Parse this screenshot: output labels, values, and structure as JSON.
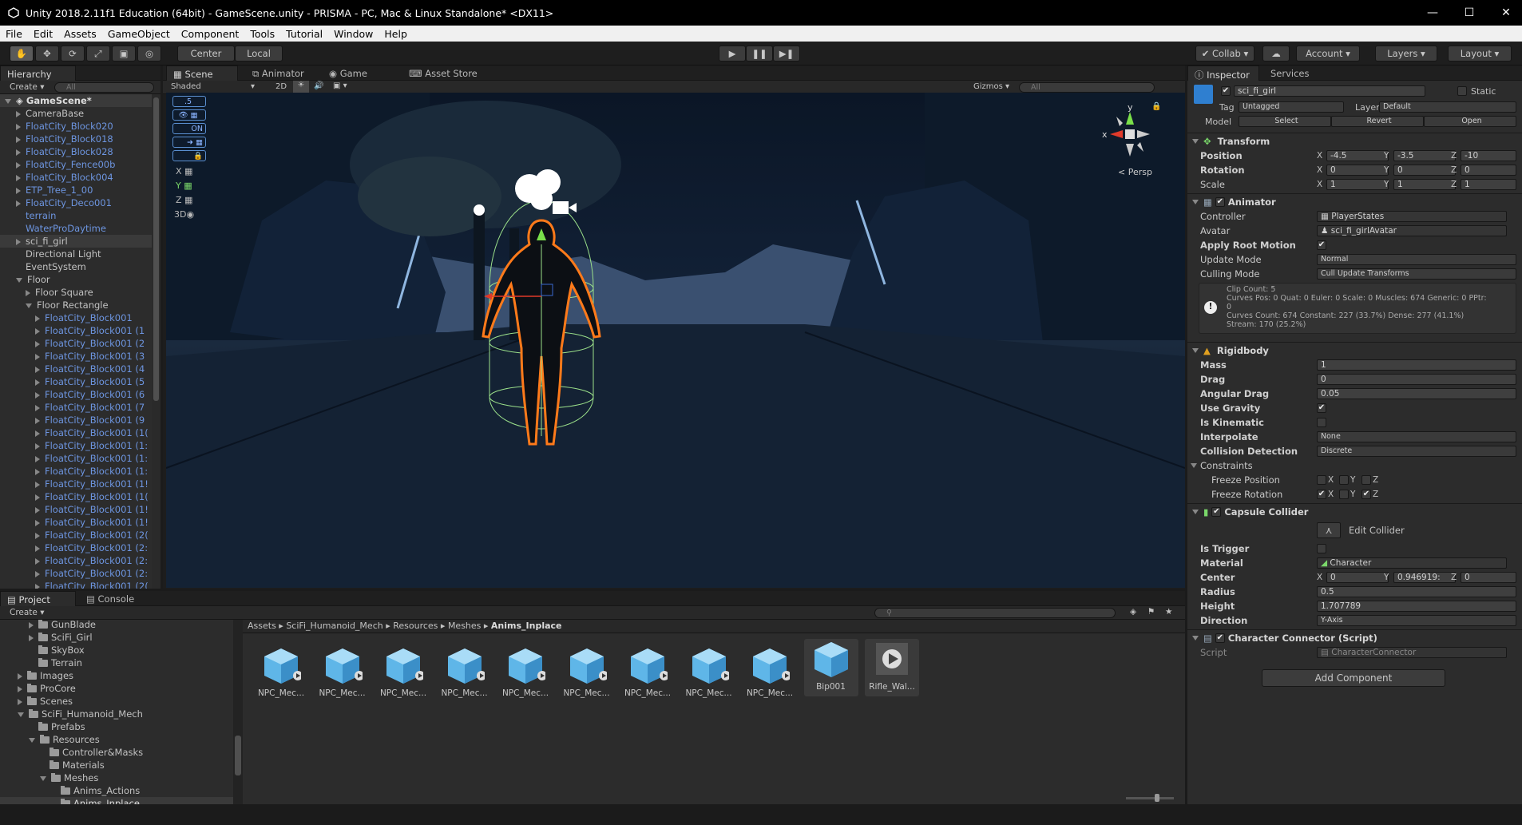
{
  "window": {
    "title": "Unity 2018.2.11f1 Education (64bit) - GameScene.unity - PRISMA - PC, Mac & Linux Standalone* <DX11>"
  },
  "menu": [
    "File",
    "Edit",
    "Assets",
    "GameObject",
    "Component",
    "Tools",
    "Tutorial",
    "Window",
    "Help"
  ],
  "toolbar": {
    "center": "Center",
    "local": "Local",
    "collab": "Collab",
    "account": "Account",
    "layers": "Layers",
    "layout": "Layout"
  },
  "hierarchy": {
    "tab": "Hierarchy",
    "create": "Create",
    "search": "All",
    "scene": "GameScene*",
    "rows": [
      {
        "label": "CameraBase",
        "fold": "closed",
        "indent": 0,
        "blue": false
      },
      {
        "label": "FloatCity_Block020",
        "fold": "closed",
        "indent": 0,
        "blue": true
      },
      {
        "label": "FloatCity_Block018",
        "fold": "closed",
        "indent": 0,
        "blue": true
      },
      {
        "label": "FloatCity_Block028",
        "fold": "closed",
        "indent": 0,
        "blue": true
      },
      {
        "label": "FloatCity_Fence00b",
        "fold": "closed",
        "indent": 0,
        "blue": true
      },
      {
        "label": "FloatCity_Block004",
        "fold": "closed",
        "indent": 0,
        "blue": true
      },
      {
        "label": "ETP_Tree_1_00",
        "fold": "closed",
        "indent": 0,
        "blue": true
      },
      {
        "label": "FloatCity_Deco001",
        "fold": "closed",
        "indent": 0,
        "blue": true
      },
      {
        "label": "terrain",
        "fold": "none",
        "indent": 0,
        "blue": true
      },
      {
        "label": "WaterProDaytime",
        "fold": "none",
        "indent": 0,
        "blue": true
      },
      {
        "label": "sci_fi_girl",
        "fold": "closed",
        "indent": 0,
        "blue": false,
        "selected": true
      },
      {
        "label": "Directional Light",
        "fold": "none",
        "indent": 0,
        "blue": false
      },
      {
        "label": "EventSystem",
        "fold": "none",
        "indent": 0,
        "blue": false
      },
      {
        "label": "Floor",
        "fold": "open",
        "indent": 0,
        "blue": false
      },
      {
        "label": "Floor Square",
        "fold": "closed",
        "indent": 1,
        "blue": false
      },
      {
        "label": "Floor Rectangle",
        "fold": "open",
        "indent": 1,
        "blue": false
      },
      {
        "label": "FloatCity_Block001",
        "fold": "closed",
        "indent": 2,
        "blue": true
      },
      {
        "label": "FloatCity_Block001 (1",
        "fold": "closed",
        "indent": 2,
        "blue": true
      },
      {
        "label": "FloatCity_Block001 (2",
        "fold": "closed",
        "indent": 2,
        "blue": true
      },
      {
        "label": "FloatCity_Block001 (3",
        "fold": "closed",
        "indent": 2,
        "blue": true
      },
      {
        "label": "FloatCity_Block001 (4",
        "fold": "closed",
        "indent": 2,
        "blue": true
      },
      {
        "label": "FloatCity_Block001 (5",
        "fold": "closed",
        "indent": 2,
        "blue": true
      },
      {
        "label": "FloatCity_Block001 (6",
        "fold": "closed",
        "indent": 2,
        "blue": true
      },
      {
        "label": "FloatCity_Block001 (7",
        "fold": "closed",
        "indent": 2,
        "blue": true
      },
      {
        "label": "FloatCity_Block001 (9",
        "fold": "closed",
        "indent": 2,
        "blue": true
      },
      {
        "label": "FloatCity_Block001 (1(",
        "fold": "closed",
        "indent": 2,
        "blue": true
      },
      {
        "label": "FloatCity_Block001 (1:",
        "fold": "closed",
        "indent": 2,
        "blue": true
      },
      {
        "label": "FloatCity_Block001 (1:",
        "fold": "closed",
        "indent": 2,
        "blue": true
      },
      {
        "label": "FloatCity_Block001 (1:",
        "fold": "closed",
        "indent": 2,
        "blue": true
      },
      {
        "label": "FloatCity_Block001 (1!",
        "fold": "closed",
        "indent": 2,
        "blue": true
      },
      {
        "label": "FloatCity_Block001 (1(",
        "fold": "closed",
        "indent": 2,
        "blue": true
      },
      {
        "label": "FloatCity_Block001 (1!",
        "fold": "closed",
        "indent": 2,
        "blue": true
      },
      {
        "label": "FloatCity_Block001 (1!",
        "fold": "closed",
        "indent": 2,
        "blue": true
      },
      {
        "label": "FloatCity_Block001 (2(",
        "fold": "closed",
        "indent": 2,
        "blue": true
      },
      {
        "label": "FloatCity_Block001 (2:",
        "fold": "closed",
        "indent": 2,
        "blue": true
      },
      {
        "label": "FloatCity_Block001 (2:",
        "fold": "closed",
        "indent": 2,
        "blue": true
      },
      {
        "label": "FloatCity_Block001 (2:",
        "fold": "closed",
        "indent": 2,
        "blue": true
      },
      {
        "label": "FloatCity_Block001 (2(",
        "fold": "closed",
        "indent": 2,
        "blue": true
      }
    ]
  },
  "scene": {
    "tabs": [
      "Scene",
      "Animator",
      "Game",
      "Asset Store"
    ],
    "shading": "Shaded",
    "mode2d": "2D",
    "gizmos": "Gizmos",
    "search": "All",
    "persp": "Persp",
    "overlay": [
      ".5",
      "ON",
      "X",
      "Y",
      "Z",
      "3D"
    ]
  },
  "inspector": {
    "tabs": [
      "Inspector",
      "Services"
    ],
    "object_name": "sci_fi_girl",
    "static": "Static",
    "tag_label": "Tag",
    "tag": "Untagged",
    "layer_label": "Layer",
    "layer": "Default",
    "model_label": "Model",
    "model_buttons": [
      "Select",
      "Revert",
      "Open"
    ],
    "transform": {
      "title": "Transform",
      "position": {
        "label": "Position",
        "x": "-4.5",
        "y": "-3.5",
        "z": "-10"
      },
      "rotation": {
        "label": "Rotation",
        "x": "0",
        "y": "0",
        "z": "0"
      },
      "scale": {
        "label": "Scale",
        "x": "1",
        "y": "1",
        "z": "1"
      }
    },
    "animator": {
      "title": "Animator",
      "controller_label": "Controller",
      "controller": "PlayerStates",
      "avatar_label": "Avatar",
      "avatar": "sci_fi_girlAvatar",
      "root_motion": "Apply Root Motion",
      "update_mode_label": "Update Mode",
      "update_mode": "Normal",
      "culling_label": "Culling Mode",
      "culling": "Cull Update Transforms",
      "info": [
        "Clip Count: 5",
        "Curves Pos: 0 Quat: 0 Euler: 0 Scale: 0 Muscles: 674 Generic: 0 PPtr:",
        "0",
        "Curves Count: 674 Constant: 227 (33.7%) Dense: 277 (41.1%)",
        "Stream: 170 (25.2%)"
      ]
    },
    "rigidbody": {
      "title": "Rigidbody",
      "mass_label": "Mass",
      "mass": "1",
      "drag_label": "Drag",
      "drag": "0",
      "angular_label": "Angular Drag",
      "angular": "0.05",
      "gravity_label": "Use Gravity",
      "kinematic_label": "Is Kinematic",
      "interpolate_label": "Interpolate",
      "interpolate": "None",
      "collision_label": "Collision Detection",
      "collision": "Discrete",
      "constraints_label": "Constraints",
      "freeze_pos": "Freeze Position",
      "freeze_rot": "Freeze Rotation"
    },
    "capsule": {
      "title": "Capsule Collider",
      "edit": "Edit Collider",
      "trigger_label": "Is Trigger",
      "material_label": "Material",
      "material": "Character",
      "center_label": "Center",
      "center_x": "0",
      "center_y": "0.946919:",
      "center_z": "0",
      "radius_label": "Radius",
      "radius": "0.5",
      "height_label": "Height",
      "height": "1.707789",
      "direction_label": "Direction",
      "direction": "Y-Axis"
    },
    "connector": {
      "title": "Character Connector (Script)",
      "script_label": "Script",
      "script": "CharacterConnector"
    },
    "add_component": "Add Component"
  },
  "project": {
    "tabs": [
      "Project",
      "Console"
    ],
    "create": "Create",
    "tree": [
      {
        "label": "GunBlade",
        "indent": 2
      },
      {
        "label": "SciFi_Girl",
        "indent": 2
      },
      {
        "label": "SkyBox",
        "indent": 2
      },
      {
        "label": "Terrain",
        "indent": 2
      },
      {
        "label": "Images",
        "indent": 1
      },
      {
        "label": "ProCore",
        "indent": 1
      },
      {
        "label": "Scenes",
        "indent": 1
      },
      {
        "label": "SciFi_Humanoid_Mech",
        "indent": 1
      },
      {
        "label": "Prefabs",
        "indent": 2
      },
      {
        "label": "Resources",
        "indent": 2
      },
      {
        "label": "Controller&Masks",
        "indent": 3
      },
      {
        "label": "Materials",
        "indent": 3
      },
      {
        "label": "Meshes",
        "indent": 3
      },
      {
        "label": "Anims_Actions",
        "indent": 4
      },
      {
        "label": "Anims_Inplace",
        "indent": 4
      }
    ],
    "breadcrumb": [
      "Assets",
      "SciFi_Humanoid_Mech",
      "Resources",
      "Meshes",
      "Anims_Inplace"
    ],
    "assets": [
      "NPC_Mec...",
      "NPC_Mec...",
      "NPC_Mec...",
      "NPC_Mec...",
      "NPC_Mec...",
      "NPC_Mec...",
      "NPC_Mec...",
      "NPC_Mec...",
      "NPC_Mec...",
      "Bip001",
      "Rifle_Wal..."
    ]
  },
  "colors": {
    "accent": "#6d95e0",
    "selection_outline": "#ff7a1a",
    "collider": "#9be08a"
  }
}
